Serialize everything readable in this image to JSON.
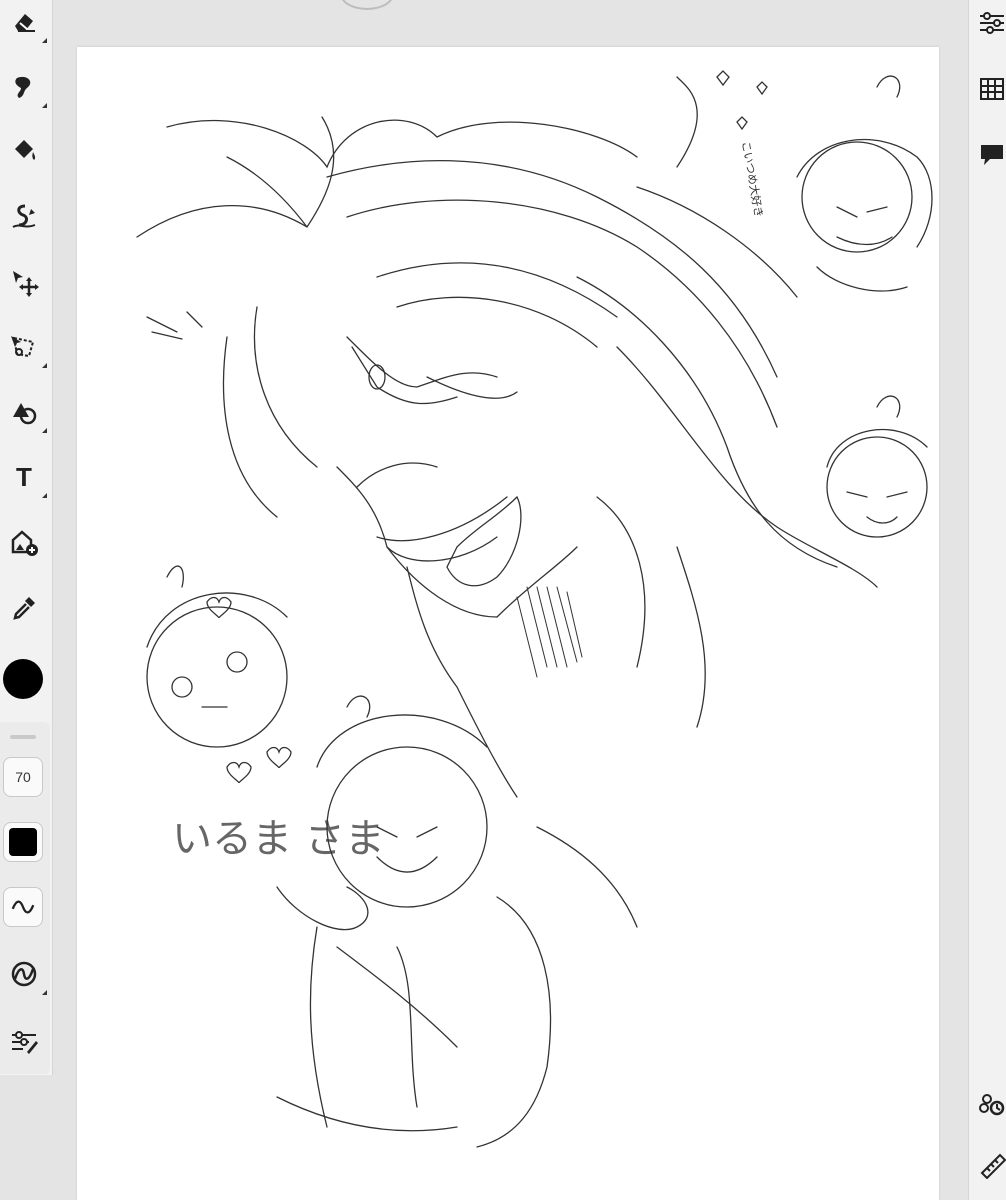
{
  "toolbar_left": {
    "tools": [
      {
        "name": "eraser-icon"
      },
      {
        "name": "smudge-icon"
      },
      {
        "name": "fill-bucket-icon"
      },
      {
        "name": "liquify-icon"
      },
      {
        "name": "move-transform-icon"
      },
      {
        "name": "lasso-select-icon"
      },
      {
        "name": "shape-icon"
      },
      {
        "name": "text-icon",
        "glyph": "T"
      },
      {
        "name": "image-import-icon"
      },
      {
        "name": "eyedropper-icon"
      }
    ],
    "brush_size": "70",
    "current_color": "#000000",
    "fill_color": "#000000"
  },
  "toolbar_right": {
    "tools": [
      {
        "name": "adjustments-icon"
      },
      {
        "name": "grid-icon"
      },
      {
        "name": "comment-icon"
      },
      {
        "name": "timelapse-icon"
      },
      {
        "name": "ruler-icon"
      }
    ]
  },
  "canvas": {
    "background": "#ffffff",
    "handwritten_text": "いるま さま",
    "side_note": "こいつめ大好き"
  }
}
